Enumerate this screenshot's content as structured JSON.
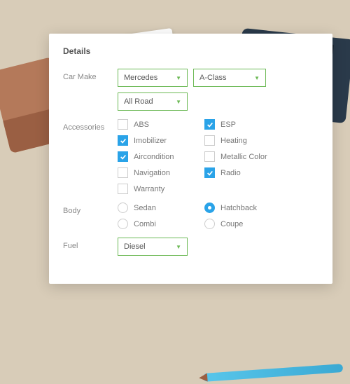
{
  "panel": {
    "title": "Details",
    "carMakeLabel": "Car Make",
    "make": "Mercedes",
    "model": "A-Class",
    "trim": "All Road",
    "accessoriesLabel": "Accessories",
    "accessories": [
      {
        "label": "ABS",
        "checked": false
      },
      {
        "label": "ESP",
        "checked": true
      },
      {
        "label": "Imobilizer",
        "checked": true
      },
      {
        "label": "Heating",
        "checked": false
      },
      {
        "label": "Aircondition",
        "checked": true
      },
      {
        "label": "Metallic Color",
        "checked": false
      },
      {
        "label": "Navigation",
        "checked": false
      },
      {
        "label": "Radio",
        "checked": true
      },
      {
        "label": "Warranty",
        "checked": false
      }
    ],
    "bodyLabel": "Body",
    "body": [
      {
        "label": "Sedan",
        "checked": false
      },
      {
        "label": "Hatchback",
        "checked": true
      },
      {
        "label": "Combi",
        "checked": false
      },
      {
        "label": "Coupe",
        "checked": false
      }
    ],
    "fuelLabel": "Fuel",
    "fuel": "Diesel"
  }
}
